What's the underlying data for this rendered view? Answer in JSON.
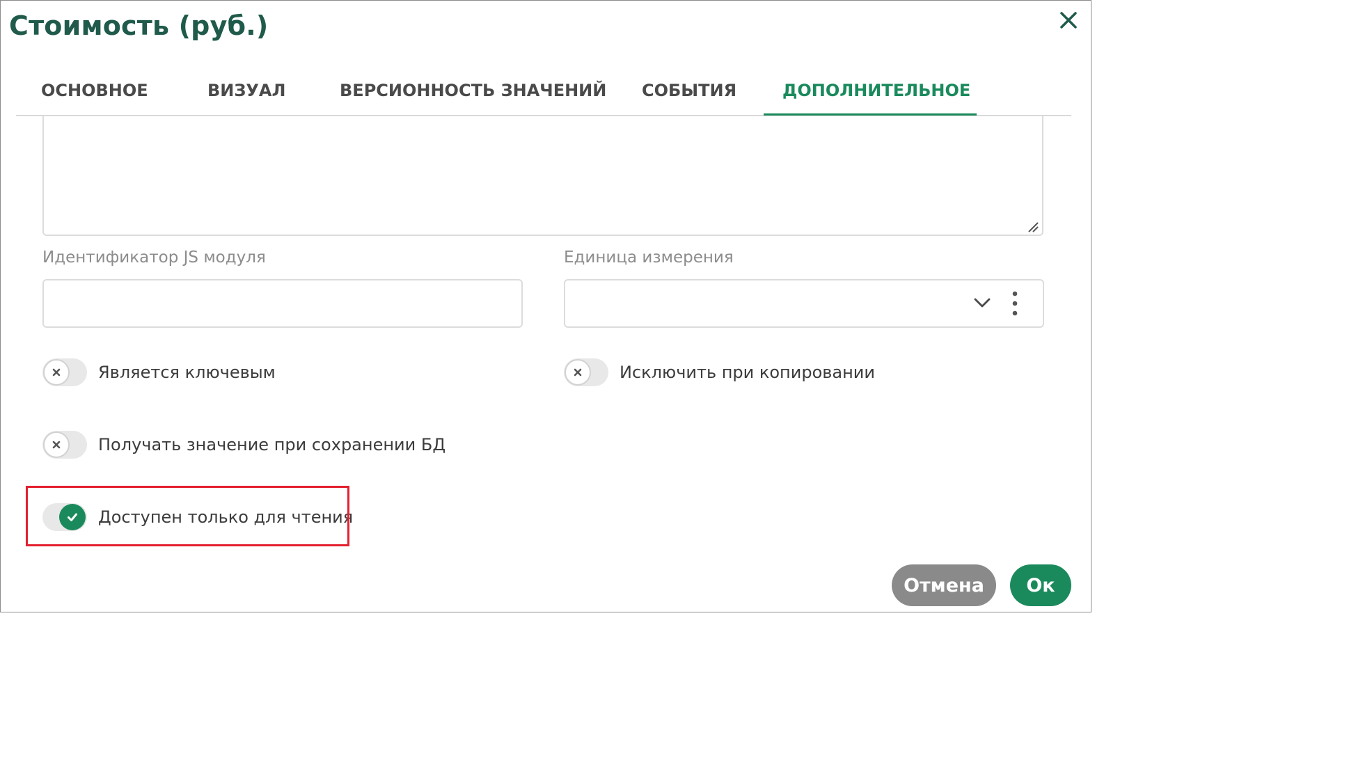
{
  "dialog": {
    "title": "Стоимость (руб.)",
    "close_icon": "close-icon"
  },
  "tabs": [
    {
      "label": "ОСНОВНОЕ",
      "active": false
    },
    {
      "label": "ВИЗУАЛ",
      "active": false
    },
    {
      "label": "ВЕРСИОННОСТЬ ЗНАЧЕНИЙ",
      "active": false
    },
    {
      "label": "СОБЫТИЯ",
      "active": false
    },
    {
      "label": "ДОПОЛНИТЕЛЬНОЕ",
      "active": true
    }
  ],
  "fields": {
    "textarea_value": "",
    "js_module": {
      "label": "Идентификатор JS модуля",
      "value": ""
    },
    "unit": {
      "label": "Единица измерения",
      "value": "",
      "icons": [
        "chevron-down-icon",
        "more-vertical-icon"
      ]
    }
  },
  "toggles": [
    {
      "label": "Является ключевым",
      "checked": false
    },
    {
      "label": "Исключить при копировании",
      "checked": false
    },
    {
      "label": "Получать значение при сохранении БД",
      "checked": false
    },
    {
      "label": "Доступен только для чтения",
      "checked": true
    }
  ],
  "buttons": {
    "cancel": "Отмена",
    "ok": "Ок"
  },
  "colors": {
    "accent": "#1a8a5c",
    "title": "#1f5a4a",
    "highlight": "#e3202f",
    "cancel_button": "#8a8a8a"
  }
}
